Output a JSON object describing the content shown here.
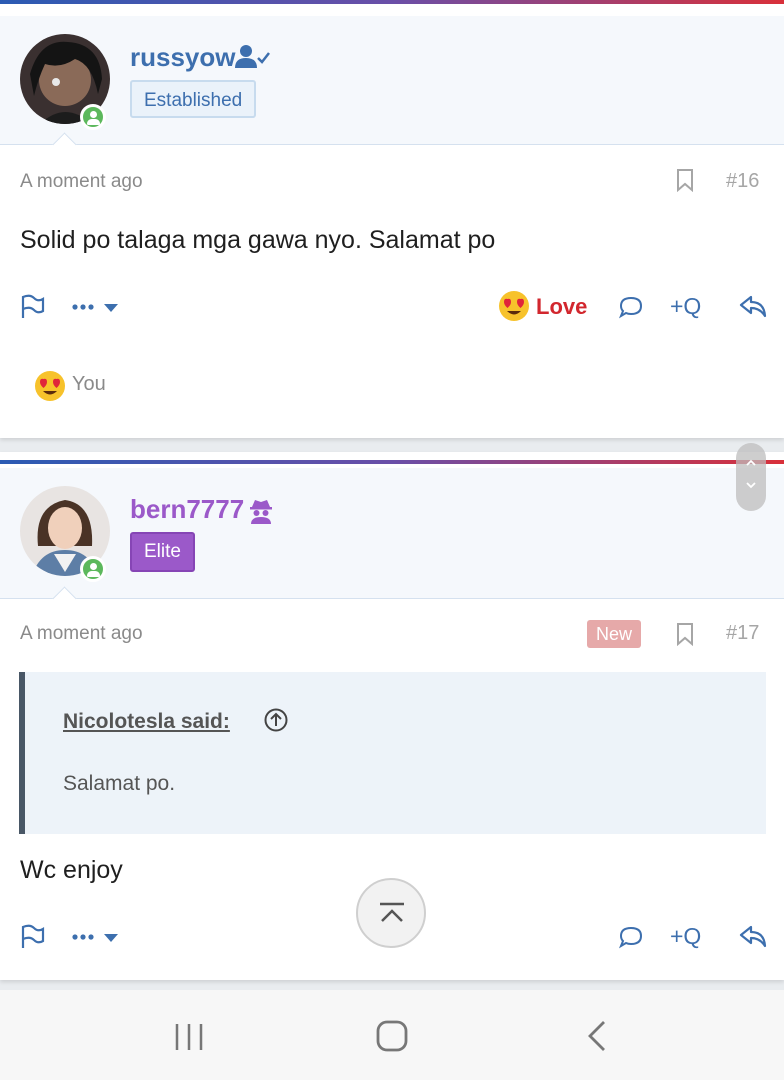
{
  "posts": [
    {
      "username": "russyow",
      "user_title": "Established",
      "time": "A moment ago",
      "post_number": "#16",
      "message": "Solid po talaga mga gawa nyo. Salamat po",
      "reaction_label": "Love",
      "reactions_summary": "You",
      "multiquote_label": "+Q",
      "username_color": "#3d6fae"
    },
    {
      "username": "bern7777",
      "user_title": "Elite",
      "time": "A moment ago",
      "badge": "New",
      "post_number": "#17",
      "quote_author": "Nicolotesla said:",
      "quote_text": "Salamat po.",
      "message": "Wc enjoy",
      "multiquote_label": "+Q",
      "username_color": "#9b59c9"
    }
  ],
  "icons": [
    "verified-user-icon",
    "spy-icon",
    "online-status-icon",
    "bookmark-icon",
    "flag-icon",
    "more-icon",
    "heart-eyes-emoji",
    "comment-icon",
    "reply-icon",
    "arrow-up-circle-icon",
    "scroll-top-icon",
    "nav-recent-icon",
    "nav-home-icon",
    "nav-back-icon"
  ],
  "colors": {
    "accent_blue": "#3d6fae",
    "love_red": "#d2272e",
    "elite_purple": "#9b59c9",
    "online_green": "#5cb85c"
  }
}
